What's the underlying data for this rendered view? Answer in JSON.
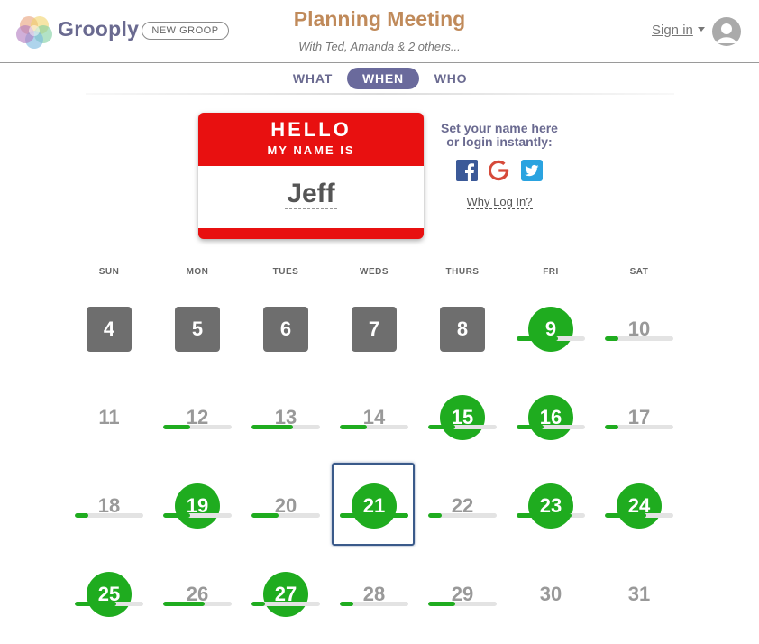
{
  "header": {
    "brand": "Grooply",
    "new_group": "NEW GROOP",
    "meeting_title": "Planning Meeting",
    "meeting_subtitle": "With Ted, Amanda & 2 others...",
    "sign_in": "Sign in",
    "avatar_icon": "user-avatar-icon"
  },
  "tabs": [
    {
      "label": "WHAT",
      "active": false
    },
    {
      "label": "WHEN",
      "active": true
    },
    {
      "label": "WHO",
      "active": false
    }
  ],
  "nametag": {
    "hello": "HELLO",
    "my_name_is": "MY NAME IS",
    "name": "Jeff"
  },
  "login": {
    "prompt_line1": "Set your name here",
    "prompt_line2": "or login instantly:",
    "why": "Why Log In?",
    "icons": [
      "facebook-icon",
      "google-icon",
      "twitter-icon"
    ]
  },
  "colors": {
    "accent": "#6a6a9c",
    "selected_green": "#1fac1f",
    "tag_red": "#e81010",
    "title_brown": "#c08a5a",
    "today_border": "#3a5a8a"
  },
  "calendar": {
    "weekdays": [
      "SUN",
      "MON",
      "TUES",
      "WEDS",
      "THURS",
      "FRI",
      "SAT"
    ],
    "weeks": [
      [
        {
          "day": "4",
          "state": "past"
        },
        {
          "day": "5",
          "state": "past"
        },
        {
          "day": "6",
          "state": "past"
        },
        {
          "day": "7",
          "state": "past"
        },
        {
          "day": "8",
          "state": "past"
        },
        {
          "day": "9",
          "state": "selected",
          "availability": 0.6
        },
        {
          "day": "10",
          "state": "open",
          "availability": 0.2
        }
      ],
      [
        {
          "day": "11",
          "state": "open"
        },
        {
          "day": "12",
          "state": "open",
          "availability": 0.4
        },
        {
          "day": "13",
          "state": "open",
          "availability": 0.6
        },
        {
          "day": "14",
          "state": "open",
          "availability": 0.4
        },
        {
          "day": "15",
          "state": "selected",
          "availability": 0.4
        },
        {
          "day": "16",
          "state": "selected",
          "availability": 0.4
        },
        {
          "day": "17",
          "state": "open",
          "availability": 0.2
        }
      ],
      [
        {
          "day": "18",
          "state": "open",
          "availability": 0.2
        },
        {
          "day": "19",
          "state": "selected",
          "availability": 0.4
        },
        {
          "day": "20",
          "state": "open",
          "availability": 0.4
        },
        {
          "day": "21",
          "state": "selected",
          "availability": 1.0,
          "today": true
        },
        {
          "day": "22",
          "state": "open",
          "availability": 0.2
        },
        {
          "day": "23",
          "state": "selected",
          "availability": 0.8
        },
        {
          "day": "24",
          "state": "selected",
          "availability": 0.6
        }
      ],
      [
        {
          "day": "25",
          "state": "selected",
          "availability": 0.6
        },
        {
          "day": "26",
          "state": "open",
          "availability": 0.6
        },
        {
          "day": "27",
          "state": "selected",
          "availability": 0.2
        },
        {
          "day": "28",
          "state": "open",
          "availability": 0.2
        },
        {
          "day": "29",
          "state": "open",
          "availability": 0.4
        },
        {
          "day": "30",
          "state": "open"
        },
        {
          "day": "31",
          "state": "open"
        }
      ]
    ]
  }
}
